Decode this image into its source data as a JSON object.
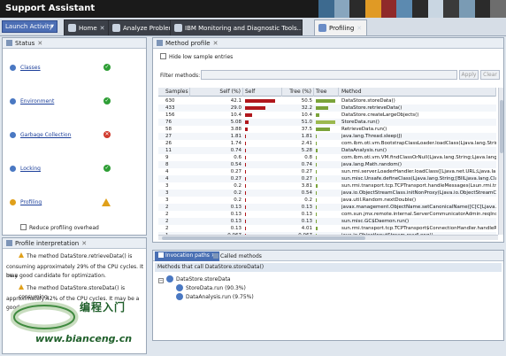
{
  "app": {
    "title": "Support Assistant"
  },
  "banner_colors": [
    "#3d6a8f",
    "#88a6be",
    "#2b2b2b",
    "#e09a25",
    "#8f2a2a",
    "#5c8ab0",
    "#2b2b2b",
    "#c9d6e2",
    "#3a3a3a",
    "#7a9bb4",
    "#2b2b2b",
    "#6d6d6d"
  ],
  "tabbar": {
    "launch_label": "Launch Activity",
    "tabs": [
      {
        "label": "Home",
        "icon": "home-icon"
      },
      {
        "label": "Analyze Problem",
        "icon": "analyze-icon"
      },
      {
        "label": "IBM Monitoring and Diagnostic Tools...",
        "icon": "tools-icon"
      },
      {
        "label": "Profiling",
        "icon": "profiling-icon"
      }
    ]
  },
  "status_panel": {
    "title": "Status",
    "items": [
      {
        "label": "Classes",
        "status": "ok",
        "color": "#4a78c2"
      },
      {
        "label": "Environment",
        "status": "ok",
        "color": "#4a78c2"
      },
      {
        "label": "Garbage Collection",
        "status": "error",
        "color": "#4a78c2"
      },
      {
        "label": "Locking",
        "status": "ok",
        "color": "#4a78c2"
      },
      {
        "label": "Profiling",
        "status": "warning",
        "color": "#e0a01a"
      }
    ],
    "reduce_label": "Reduce profiling overhead"
  },
  "interp_panel": {
    "title": "Profile interpretation",
    "messages": [
      "The method DataStore.retrieveData() is",
      "consuming approximately 29% of the CPU cycles. It may",
      "be a good candidate for optimization.",
      "The method DataStore.storeData() is consuming",
      "approximately 42% of the CPU cycles. It may be a good"
    ]
  },
  "method_panel": {
    "title": "Method profile",
    "hide_low_label": "Hide low sample entries",
    "filter_label": "Filter methods:",
    "apply_label": "Apply",
    "clear_label": "Clear",
    "columns": {
      "samples": "Samples",
      "self_pct": "Self (%)",
      "self": "Self",
      "tree_pct": "Tree (%)",
      "tree": "Tree",
      "method": "Method"
    },
    "rows": [
      {
        "samples": "630",
        "self": "42.1",
        "tree": "50.5",
        "method": "DataStore.storeData()",
        "selfv": 42.1,
        "treev": 50.5
      },
      {
        "samples": "433",
        "self": "29.0",
        "tree": "32.2",
        "method": "DataStore.retrieveData()",
        "selfv": 29.0,
        "treev": 32.2
      },
      {
        "samples": "156",
        "self": "10.4",
        "tree": "10.4",
        "method": "DataStore.createLargeObjects()",
        "selfv": 10.4,
        "treev": 10.4
      },
      {
        "samples": "76",
        "self": "5.08",
        "tree": "51.0",
        "method": "StoreData.run()",
        "selfv": 5.08,
        "treev": 51.0
      },
      {
        "samples": "58",
        "self": "3.88",
        "tree": "37.5",
        "method": "RetrieveData.run()",
        "selfv": 3.88,
        "treev": 37.5
      },
      {
        "samples": "27",
        "self": "1.81",
        "tree": "1.81",
        "method": "java.lang.Thread.sleep(J)",
        "selfv": 1.81,
        "treev": 1.81
      },
      {
        "samples": "26",
        "self": "1.74",
        "tree": "2.41",
        "method": "com.ibm.oti.vm.BootstrapClassLoader.loadClass(Ljava.lang.String;)",
        "selfv": 1.74,
        "treev": 2.41
      },
      {
        "samples": "11",
        "self": "0.74",
        "tree": "5.28",
        "method": "DataAnalysis.run()",
        "selfv": 0.74,
        "treev": 5.28
      },
      {
        "samples": "9",
        "self": "0.6",
        "tree": "0.8",
        "method": "com.ibm.oti.vm.VM.findClassOrNull(Ljava.lang.String;Ljava.lang.",
        "selfv": 0.6,
        "treev": 0.8
      },
      {
        "samples": "8",
        "self": "0.54",
        "tree": "0.74",
        "method": "java.lang.Math.random()",
        "selfv": 0.54,
        "treev": 0.74
      },
      {
        "samples": "4",
        "self": "0.27",
        "tree": "0.27",
        "method": "sun.rmi.server.LoaderHandler.loadClass([Ljava.net.URL;Ljava.la",
        "selfv": 0.27,
        "treev": 0.27
      },
      {
        "samples": "4",
        "self": "0.27",
        "tree": "0.27",
        "method": "sun.misc.Unsafe.defineClass(Ljava.lang.String;[BIILjava.lang.Cla",
        "selfv": 0.27,
        "treev": 0.27
      },
      {
        "samples": "3",
        "self": "0.2",
        "tree": "3.81",
        "method": "sun.rmi.transport.tcp.TCPTransport.handleMessages(Lsun.rmi.tra",
        "selfv": 0.2,
        "treev": 3.81
      },
      {
        "samples": "3",
        "self": "0.2",
        "tree": "0.54",
        "method": "java.io.ObjectStreamClass.initNonProxy(Ljava.io.ObjectStreamCl",
        "selfv": 0.2,
        "treev": 0.54
      },
      {
        "samples": "3",
        "self": "0.2",
        "tree": "0.2",
        "method": "java.util.Random.nextDouble()",
        "selfv": 0.2,
        "treev": 0.2
      },
      {
        "samples": "2",
        "self": "0.13",
        "tree": "0.13",
        "method": "javax.management.ObjectName.setCanonicalName([C[C[Ljava.la",
        "selfv": 0.13,
        "treev": 0.13
      },
      {
        "samples": "2",
        "self": "0.13",
        "tree": "0.13",
        "method": "com.sun.jmx.remote.internal.ServerCommunicatorAdmin.reqInco",
        "selfv": 0.13,
        "treev": 0.13
      },
      {
        "samples": "2",
        "self": "0.13",
        "tree": "0.13",
        "method": "sun.misc.GC$Daemon.run()",
        "selfv": 0.13,
        "treev": 0.13
      },
      {
        "samples": "2",
        "self": "0.13",
        "tree": "4.01",
        "method": "sun.rmi.transport.tcp.TCPTransport$ConnectionHandler.handleR",
        "selfv": 0.13,
        "treev": 4.01
      },
      {
        "samples": "1",
        "self": "0.067",
        "tree": "0.067",
        "method": "java.io.ObjectInputStream.readLong()",
        "selfv": 0.067,
        "treev": 0.067
      }
    ]
  },
  "invocation_panel": {
    "tab_active": "Invocation paths",
    "tab_other": "Called methods",
    "heading": "Methods that call DataStore.storeData()",
    "root": "DataStore.storeData",
    "children": [
      "StoreData.run (90.3%)",
      "DataAnalysis.run (9.75%)"
    ]
  },
  "watermark": {
    "cn": "编程入门",
    "url": "www.bianceng.cn"
  }
}
